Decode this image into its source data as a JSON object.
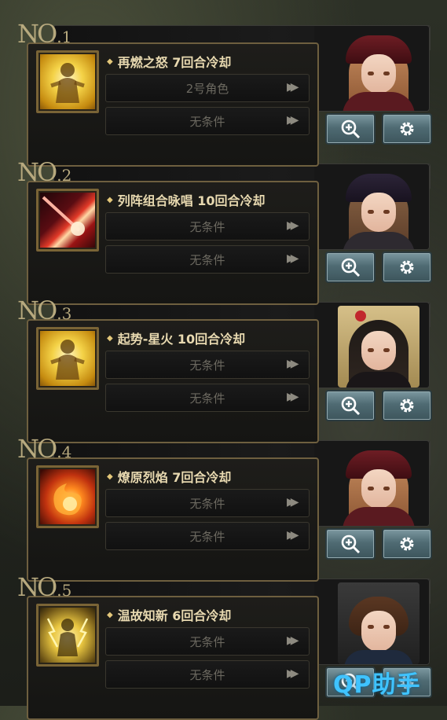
{
  "entries": [
    {
      "no_prefix": "N",
      "no_o": "O",
      "no_num": ".1",
      "skill": "再燃之怒 7回合冷却",
      "conditions": [
        "2号角色",
        "无条件"
      ],
      "icon": "gold-warrior-icon",
      "portrait": "red-hood-girl-portrait"
    },
    {
      "no_prefix": "N",
      "no_o": "O",
      "no_num": ".2",
      "skill": "列阵组合咏唱 10回合冷却",
      "conditions": [
        "无条件",
        "无条件"
      ],
      "icon": "red-beam-icon",
      "portrait": "witch-girl-portrait"
    },
    {
      "no_prefix": "N",
      "no_o": "O",
      "no_num": ".3",
      "skill": "起势-星火 10回合冷却",
      "conditions": [
        "无条件",
        "无条件"
      ],
      "icon": "gold-warrior-icon",
      "portrait": "dark-hair-girl-portrait"
    },
    {
      "no_prefix": "N",
      "no_o": "O",
      "no_num": ".4",
      "skill": "燎原烈焰 7回合冷却",
      "conditions": [
        "无条件",
        "无条件"
      ],
      "icon": "fireball-icon",
      "portrait": "red-hood-girl-portrait"
    },
    {
      "no_prefix": "N",
      "no_o": "O",
      "no_num": ".5",
      "skill": "温故知新 6回合冷却",
      "conditions": [
        "无条件",
        "无条件"
      ],
      "icon": "lightning-warrior-icon",
      "portrait": "brown-hair-man-portrait"
    }
  ],
  "icons": {
    "zoom": "zoom-in-icon",
    "settings": "gear-icon",
    "arrow": "double-arrow-icon"
  },
  "colors": {
    "panel_border": "#6e5f3f",
    "title_text": "#e8d9b0",
    "condition_text": "#6c6960",
    "button": "#5f7d85",
    "watermark": "#3fc3ff"
  },
  "watermark": "QP助手"
}
